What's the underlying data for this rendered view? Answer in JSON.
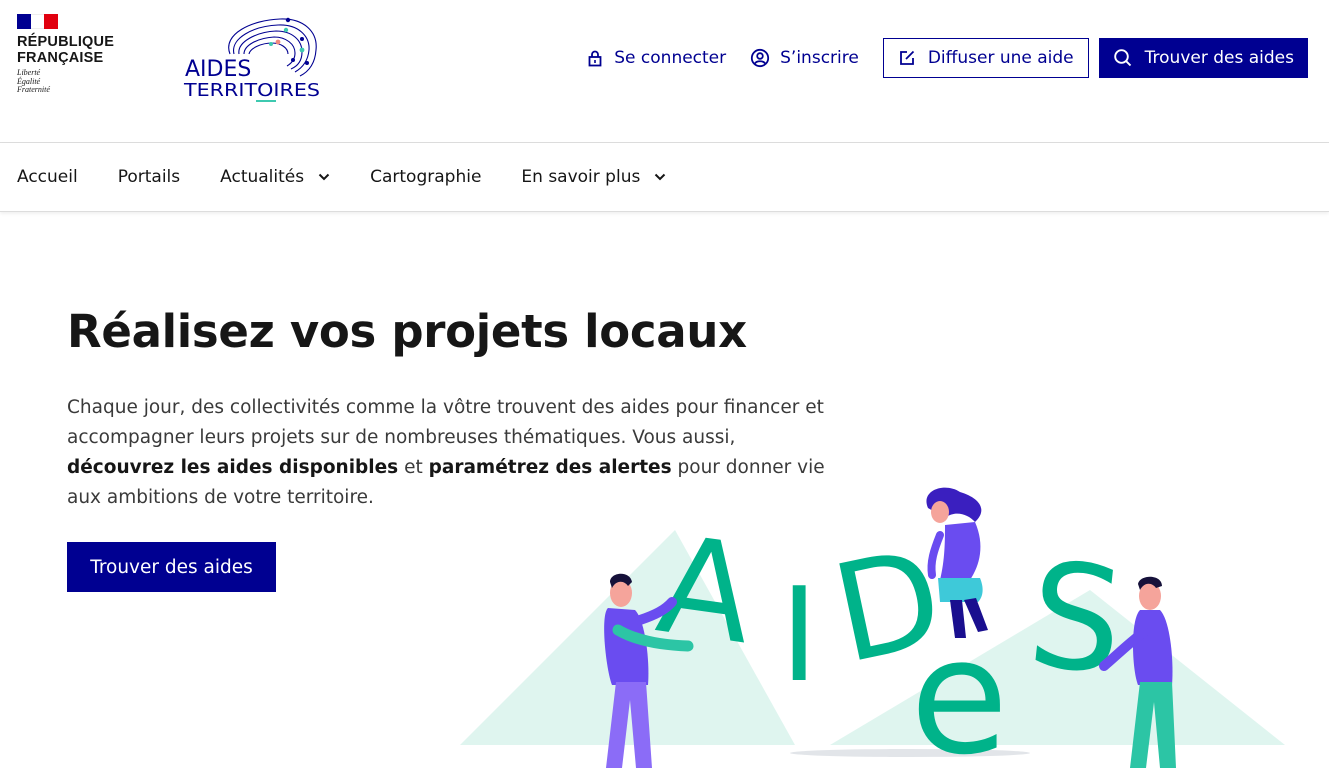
{
  "header": {
    "gov_logo": {
      "name_line1": "RÉPUBLIQUE",
      "name_line2": "FRANÇAISE",
      "motto_1": "Liberté",
      "motto_2": "Égalité",
      "motto_3": "Fraternité"
    },
    "site_logo": {
      "line1": "AIDES",
      "line2": "TERRITOIRES",
      "colors": {
        "navy": "#000091",
        "pin": "#f08a7d",
        "teal": "#3ec9b0"
      }
    },
    "tools": {
      "login_label": "Se connecter",
      "register_label": "S’inscrire",
      "post_aid_label": "Diffuser une aide",
      "find_aids_label": "Trouver des aides"
    }
  },
  "nav": {
    "items": [
      {
        "label": "Accueil",
        "has_dropdown": false
      },
      {
        "label": "Portails",
        "has_dropdown": false
      },
      {
        "label": "Actualités",
        "has_dropdown": true
      },
      {
        "label": "Cartographie",
        "has_dropdown": false
      },
      {
        "label": "En savoir plus",
        "has_dropdown": true
      }
    ]
  },
  "hero": {
    "title": "Réalisez vos projets locaux",
    "text_part1": "Chaque jour, des collectivités comme la vôtre trouvent des aides pour financer et accompagner leurs projets sur de nombreuses thématiques. Vous aussi, ",
    "text_bold1": "découvrez les aides disponibles",
    "text_part2": " et ",
    "text_bold2": "paramétrez des alertes",
    "text_part3": " pour donner vie aux ambitions de votre territoire.",
    "button_label": "Trouver des aides",
    "illustration_letters": [
      "A",
      "I",
      "D",
      "e",
      "S"
    ]
  },
  "colors": {
    "primary": "#000091",
    "accent_green": "#00b38a",
    "accent_light": "#c8efe4",
    "figure_purple": "#6a4cf0"
  }
}
